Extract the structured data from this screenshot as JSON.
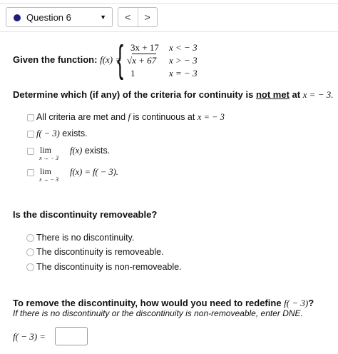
{
  "header": {
    "question_label": "Question 6",
    "prev_glyph": "<",
    "next_glyph": ">"
  },
  "function_def": {
    "intro": "Given the function:",
    "lhs": "f(x) =",
    "case1_expr": "3x + 17",
    "case1_cond": "x <  − 3",
    "case2_expr": "x + 67",
    "case2_cond": "x >  − 3",
    "case3_expr": "1",
    "case3_cond": "x =  − 3"
  },
  "criteria_question": {
    "prefix": "Determine which (if any) of the criteria for continuity is ",
    "emphasis": "not met",
    "suffix": " at ",
    "point": "x =  − 3."
  },
  "criteria_options": {
    "opt1_text": "All criteria are met and ",
    "opt1_f": "f",
    "opt1_mid": " is continuous at ",
    "opt1_point": "x =  − 3",
    "opt2_math": "f( − 3)",
    "opt2_text": " exists.",
    "opt3_lim": "lim",
    "opt3_sub": "x → − 3",
    "opt3_math": "f(x)",
    "opt3_text": " exists.",
    "opt4_lim": "lim",
    "opt4_sub": "x → − 3",
    "opt4_math": "f(x) = f( − 3)."
  },
  "discontinuity_question": {
    "label": "Is the discontinuity removeable?",
    "options": [
      "There is no discontinuity.",
      "The discontinuity is removeable.",
      "The discontinuity is non-removeable."
    ]
  },
  "redefine": {
    "prompt_prefix": "To remove the discontinuity, how would you need to redefine ",
    "prompt_math": "f( − 3)",
    "prompt_suffix": "?",
    "hint": "If there is no discontinuity or the discontinuity is non-removeable, enter DNE.",
    "answer_label": "f( − 3) =",
    "answer_value": ""
  },
  "colors": {
    "question_dot": "#1f1f7a",
    "border": "#bdbdbd"
  },
  "icons": [
    "question-status-dot-icon",
    "dropdown-caret-icon",
    "chevron-left-icon",
    "chevron-right-icon"
  ]
}
